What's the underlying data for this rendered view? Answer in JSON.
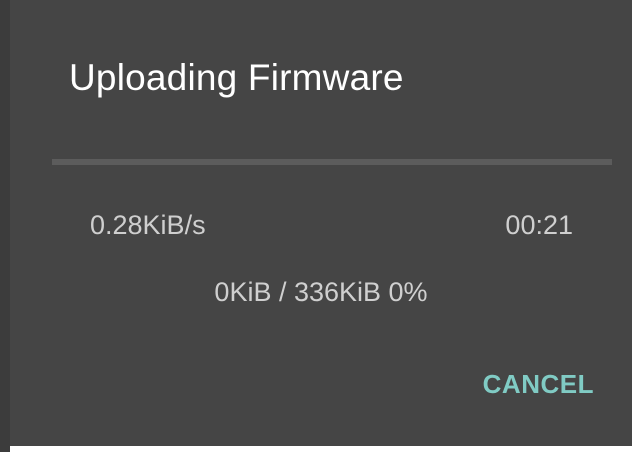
{
  "dialog": {
    "title": "Uploading Firmware",
    "progress_fraction": 0.0,
    "speed": "0.28KiB/s",
    "time": "00:21",
    "size_status": "0KiB / 336KiB 0%",
    "cancel_label": "CANCEL"
  },
  "colors": {
    "dialog_background": "#454545",
    "accent": "#80cbc4",
    "title_text": "#ffffff",
    "body_text": "#cfcfcf",
    "progress_track": "#5c5c5c"
  }
}
